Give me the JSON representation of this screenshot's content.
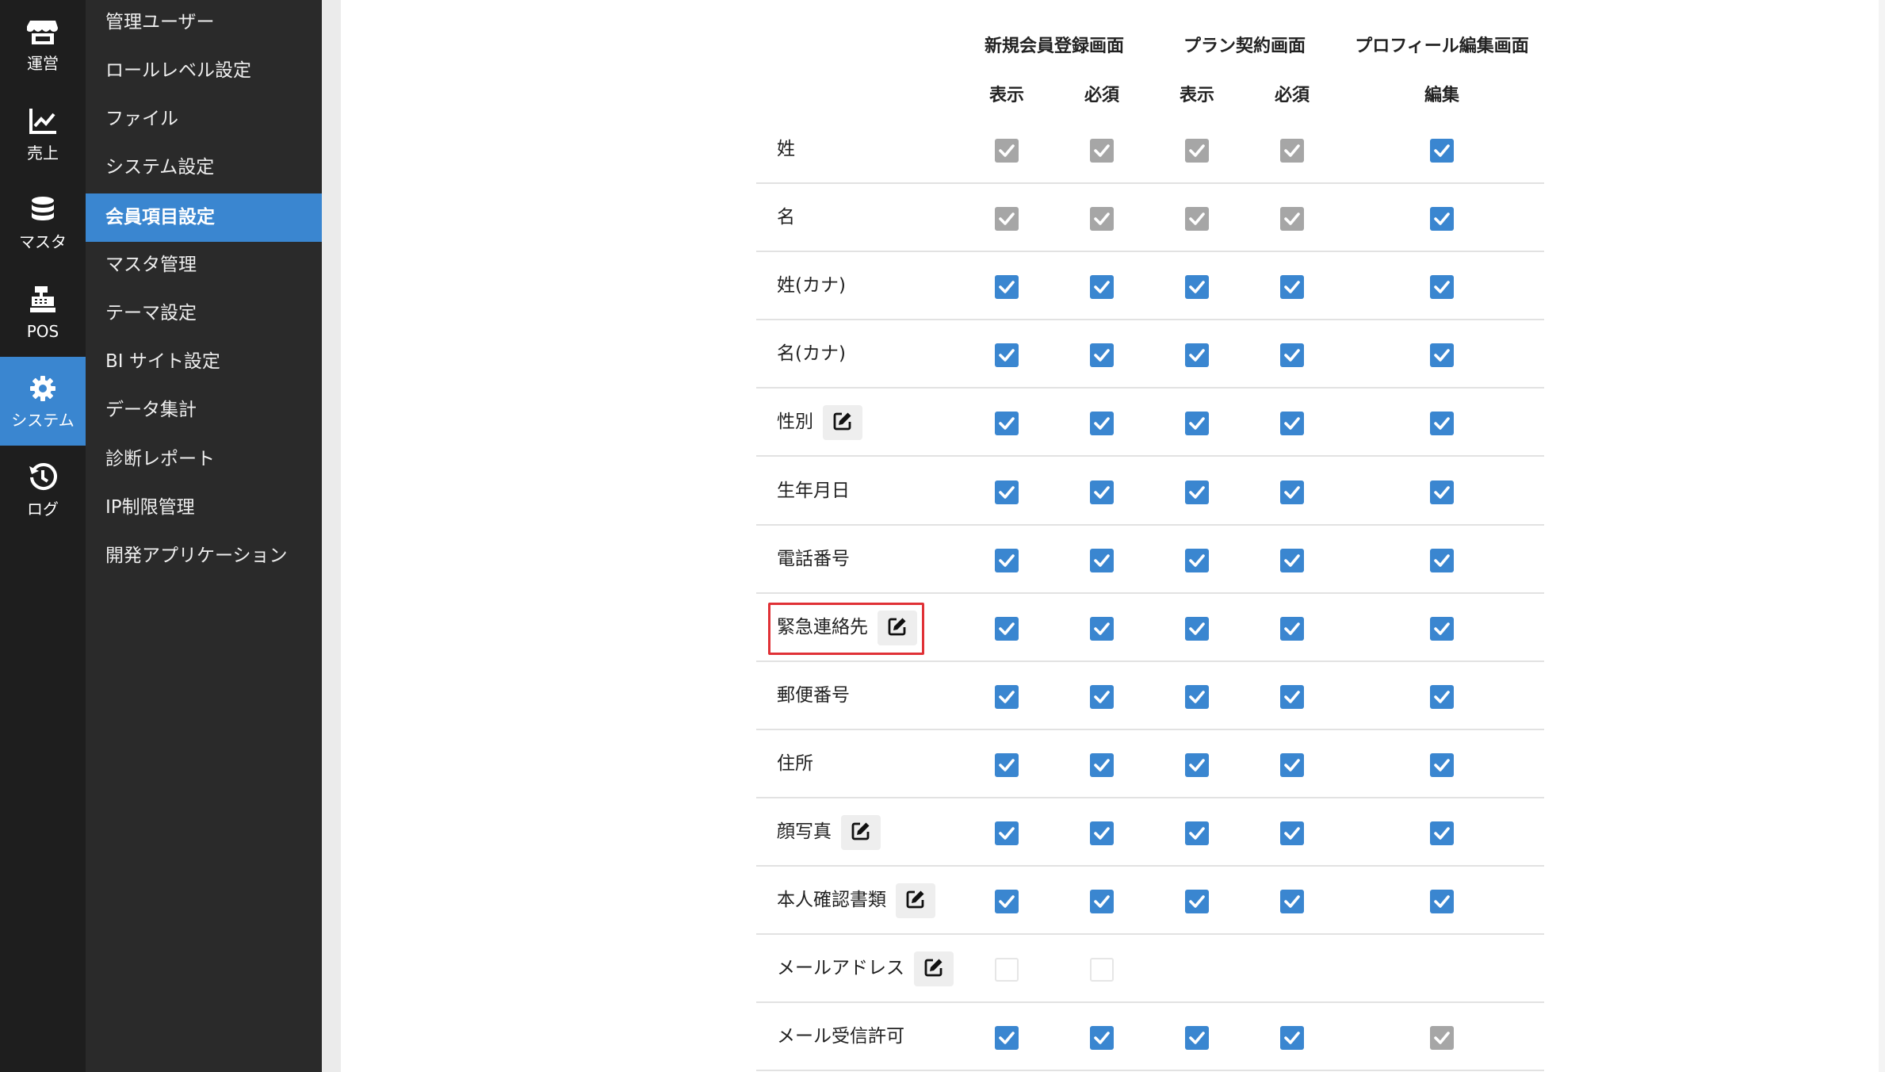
{
  "rail": [
    {
      "label": "運営",
      "icon": "store-icon"
    },
    {
      "label": "売上",
      "icon": "chart-line-icon"
    },
    {
      "label": "マスタ",
      "icon": "database-icon"
    },
    {
      "label": "POS",
      "icon": "cash-register-icon"
    },
    {
      "label": "システム",
      "icon": "gear-icon",
      "active": true
    },
    {
      "label": "ログ",
      "icon": "history-icon"
    }
  ],
  "submenu": [
    {
      "label": "管理ユーザー"
    },
    {
      "label": "ロールレベル設定"
    },
    {
      "label": "ファイル"
    },
    {
      "label": "システム設定"
    },
    {
      "label": "会員項目設定",
      "active": true
    },
    {
      "label": "マスタ管理"
    },
    {
      "label": "テーマ設定"
    },
    {
      "label": "BI サイト設定"
    },
    {
      "label": "データ集計"
    },
    {
      "label": "診断レポート"
    },
    {
      "label": "IP制限管理"
    },
    {
      "label": "開発アプリケーション"
    }
  ],
  "table": {
    "groups": [
      {
        "label": "新規会員登録画面"
      },
      {
        "label": "プラン契約画面"
      },
      {
        "label": "プロフィール編集画面"
      }
    ],
    "subheaders": [
      "表示",
      "必須",
      "表示",
      "必須",
      "編集"
    ],
    "rows": [
      {
        "label": "姓",
        "editable": false,
        "cells": [
          "disabled",
          "disabled",
          "disabled",
          "disabled",
          "checked"
        ]
      },
      {
        "label": "名",
        "editable": false,
        "cells": [
          "disabled",
          "disabled",
          "disabled",
          "disabled",
          "checked"
        ]
      },
      {
        "label": "姓(カナ)",
        "editable": false,
        "cells": [
          "checked",
          "checked",
          "checked",
          "checked",
          "checked"
        ]
      },
      {
        "label": "名(カナ)",
        "editable": false,
        "cells": [
          "checked",
          "checked",
          "checked",
          "checked",
          "checked"
        ]
      },
      {
        "label": "性別",
        "editable": true,
        "cells": [
          "checked",
          "checked",
          "checked",
          "checked",
          "checked"
        ]
      },
      {
        "label": "生年月日",
        "editable": false,
        "cells": [
          "checked",
          "checked",
          "checked",
          "checked",
          "checked"
        ]
      },
      {
        "label": "電話番号",
        "editable": false,
        "cells": [
          "checked",
          "checked",
          "checked",
          "checked",
          "checked"
        ]
      },
      {
        "label": "緊急連絡先",
        "editable": true,
        "cells": [
          "checked",
          "checked",
          "checked",
          "checked",
          "checked"
        ]
      },
      {
        "label": "郵便番号",
        "editable": false,
        "cells": [
          "checked",
          "checked",
          "checked",
          "checked",
          "checked"
        ]
      },
      {
        "label": "住所",
        "editable": false,
        "cells": [
          "checked",
          "checked",
          "checked",
          "checked",
          "checked"
        ]
      },
      {
        "label": "顔写真",
        "editable": true,
        "cells": [
          "checked",
          "checked",
          "checked",
          "checked",
          "checked"
        ]
      },
      {
        "label": "本人確認書類",
        "editable": true,
        "cells": [
          "checked",
          "checked",
          "checked",
          "checked",
          "checked"
        ]
      },
      {
        "label": "メールアドレス",
        "editable": true,
        "cells": [
          "unchecked",
          "unchecked",
          null,
          null,
          null
        ]
      },
      {
        "label": "メール受信許可",
        "editable": false,
        "cells": [
          "checked",
          "checked",
          "checked",
          "checked",
          "disabled"
        ]
      }
    ]
  },
  "highlighted_row": "緊急連絡先",
  "colors": {
    "accent": "#3a86d0",
    "disabled_check": "#a6a6a6",
    "rail_bg": "#1e1e1e",
    "submenu_bg": "#2a2a2a",
    "highlight": "#e03136"
  }
}
